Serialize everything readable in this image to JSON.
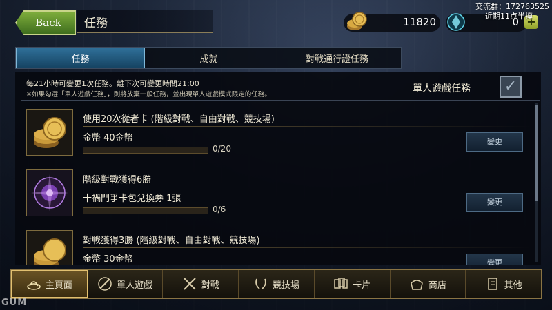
{
  "header": {
    "back_label": "Back",
    "title": "任務",
    "gold": "11820",
    "crystals": "0",
    "overlay_line1": "交流群：172763525",
    "overlay_line2": "近期11点半摸"
  },
  "tabs": [
    {
      "label": "任務",
      "active": true
    },
    {
      "label": "成就",
      "active": false
    },
    {
      "label": "對戰通行證任務",
      "active": false
    }
  ],
  "info": {
    "line1": "每21小時可變更1次任務。離下次可變更時間21:00",
    "line2": "※如果勾選「單人遊戲任務」，則將放棄一般任務，並出現單人遊戲模式限定的任務。",
    "single_player_label": "單人遊戲任務"
  },
  "quests": [
    {
      "title": "使用20次從者卡 (階級對戰、自由對戰、競技場)",
      "reward": "金幣 40金幣",
      "progress": "0/20",
      "progress_fraction": 0,
      "change_label": "變更",
      "icon": "gold-coins-icon"
    },
    {
      "title": "階級對戰獲得6勝",
      "reward": "十禍門爭卡包兌換券 1張",
      "progress": "0/6",
      "progress_fraction": 0,
      "change_label": "變更",
      "icon": "card-pack-ticket-icon"
    },
    {
      "title": "對戰獲得3勝 (階級對戰、自由對戰、競技場)",
      "reward": "金幣 30金幣",
      "progress": "",
      "progress_fraction": 0,
      "change_label": "變更",
      "icon": "gold-coins-icon"
    }
  ],
  "nav": [
    {
      "label": "主頁面",
      "icon": "home-icon",
      "active": true
    },
    {
      "label": "單人遊戲",
      "icon": "no-sword-icon",
      "active": false
    },
    {
      "label": "對戰",
      "icon": "crossed-swords-icon",
      "active": false
    },
    {
      "label": "競技場",
      "icon": "laurel-icon",
      "active": false
    },
    {
      "label": "卡片",
      "icon": "cards-icon",
      "active": false
    },
    {
      "label": "商店",
      "icon": "shop-icon",
      "active": false
    },
    {
      "label": "其他",
      "icon": "scroll-icon",
      "active": false
    }
  ],
  "watermark": "GUM",
  "colors": {
    "accent_tab": "#2f6f98",
    "gold_border": "#8a7444",
    "back_button": "#7fae3c"
  }
}
